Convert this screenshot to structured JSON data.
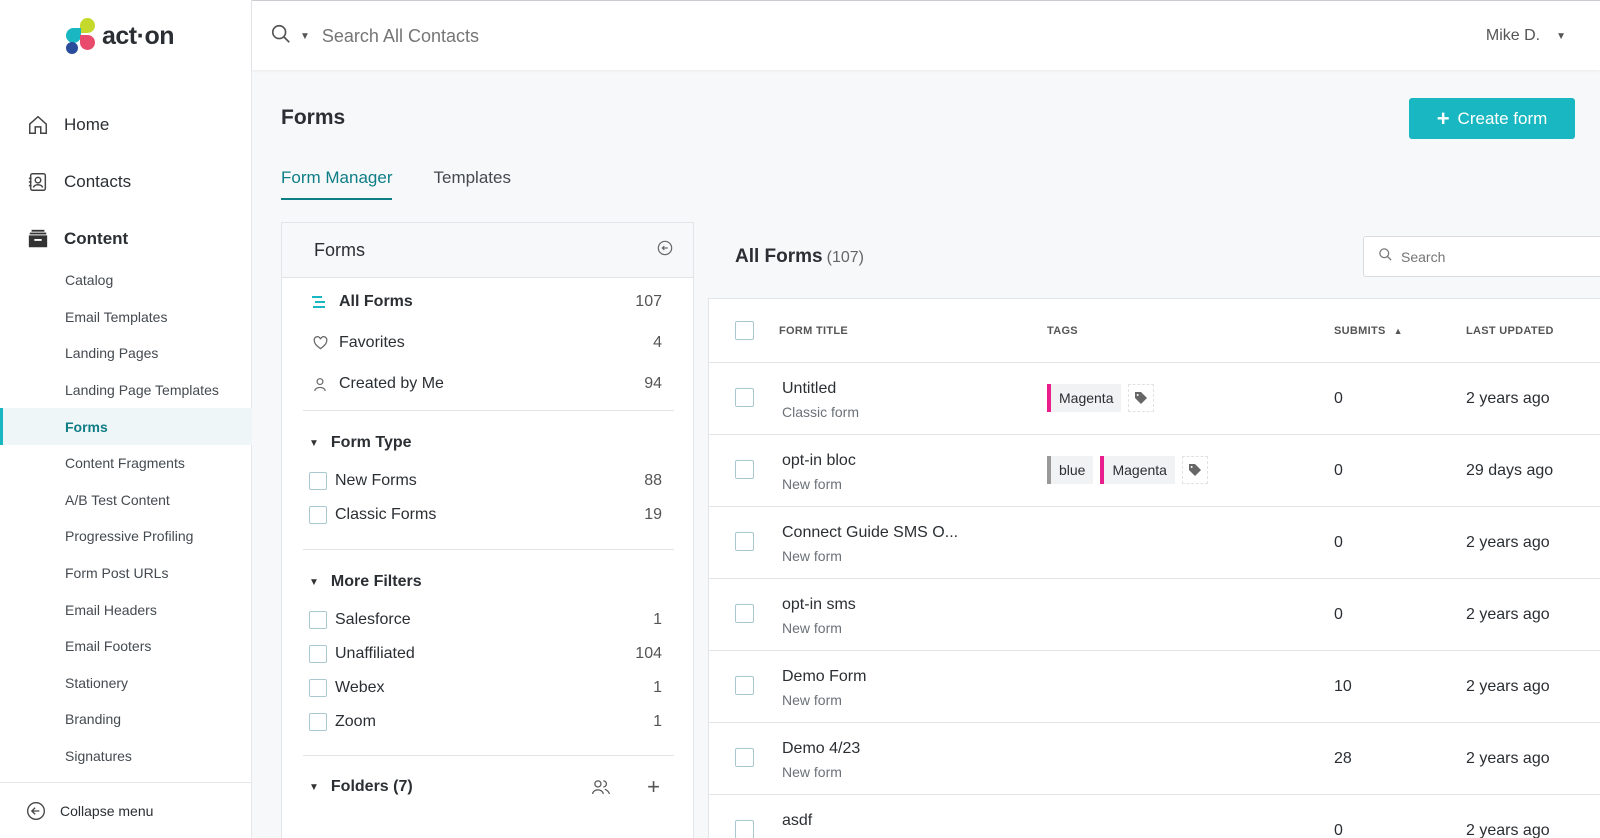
{
  "app": {
    "logo_text": "act·on"
  },
  "header": {
    "search_placeholder": "Search All Contacts",
    "user": "Mike D."
  },
  "nav": {
    "main": [
      {
        "label": "Home",
        "icon": "home-icon"
      },
      {
        "label": "Contacts",
        "icon": "contacts-icon"
      },
      {
        "label": "Content",
        "icon": "content-icon"
      }
    ],
    "content_items": [
      "Catalog",
      "Email Templates",
      "Landing Pages",
      "Landing Page Templates",
      "Forms",
      "Content Fragments",
      "A/B Test Content",
      "Progressive Profiling",
      "Form Post URLs",
      "Email Headers",
      "Email Footers",
      "Stationery",
      "Branding",
      "Signatures"
    ],
    "active_item": "Forms",
    "collapse_label": "Collapse menu"
  },
  "page": {
    "title": "Forms",
    "create_label": "Create form",
    "tabs": [
      "Form Manager",
      "Templates"
    ]
  },
  "filters": {
    "title": "Forms",
    "quick": [
      {
        "label": "All Forms",
        "count": "107"
      },
      {
        "label": "Favorites",
        "count": "4"
      },
      {
        "label": "Created by Me",
        "count": "94"
      }
    ],
    "form_type": {
      "label": "Form Type",
      "items": [
        {
          "label": "New Forms",
          "count": "88"
        },
        {
          "label": "Classic Forms",
          "count": "19"
        }
      ]
    },
    "more_filters": {
      "label": "More Filters",
      "items": [
        {
          "label": "Salesforce",
          "count": "1"
        },
        {
          "label": "Unaffiliated",
          "count": "104"
        },
        {
          "label": "Webex",
          "count": "1"
        },
        {
          "label": "Zoom",
          "count": "1"
        }
      ]
    },
    "folders_label": "Folders (7)"
  },
  "list": {
    "title": "All Forms",
    "count": "(107)",
    "search_placeholder": "Search",
    "columns": [
      "FORM TITLE",
      "TAGS",
      "SUBMITS",
      "LAST UPDATED"
    ],
    "rows": [
      {
        "title": "Untitled",
        "type": "Classic form",
        "tags": [
          {
            "label": "Magenta",
            "color": "#e91e8c"
          }
        ],
        "submits": "0",
        "updated": "2 years ago"
      },
      {
        "title": "opt-in bloc",
        "type": "New form",
        "tags": [
          {
            "label": "blue",
            "color": "#999999"
          },
          {
            "label": "Magenta",
            "color": "#e91e8c"
          }
        ],
        "submits": "0",
        "updated": "29 days ago"
      },
      {
        "title": "Connect Guide SMS O...",
        "type": "New form",
        "tags": [],
        "submits": "0",
        "updated": "2 years ago"
      },
      {
        "title": "opt-in sms",
        "type": "New form",
        "tags": [],
        "submits": "0",
        "updated": "2 years ago"
      },
      {
        "title": "Demo Form",
        "type": "New form",
        "tags": [],
        "submits": "10",
        "updated": "2 years ago"
      },
      {
        "title": "Demo 4/23",
        "type": "New form",
        "tags": [],
        "submits": "28",
        "updated": "2 years ago"
      },
      {
        "title": "asdf",
        "type": "",
        "tags": [],
        "submits": "0",
        "updated": "2 years ago"
      }
    ]
  },
  "colors": {
    "accent": "#19b7c2",
    "accent_dark": "#0f7d86",
    "tag_magenta": "#e91e8c"
  }
}
